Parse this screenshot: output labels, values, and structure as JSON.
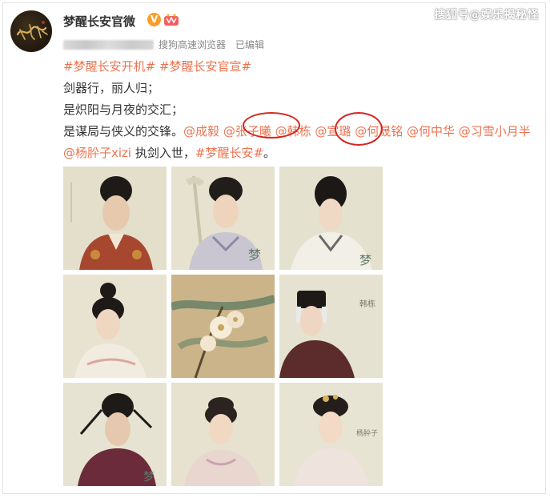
{
  "watermark": "搜狐号@娱乐揭秘怪",
  "account": {
    "name": "梦醒长安官微",
    "verified_mark": "V",
    "avatar_calligraphy": "梦醒长安"
  },
  "meta": {
    "source": "搜狗高速浏览器",
    "edited": "已编辑"
  },
  "post": {
    "hashtag_1": "#梦醒长安开机#",
    "hashtag_2": "#梦醒长安官宣#",
    "line_1": "剑器行，丽人归；",
    "line_2": "是炽阳与月夜的交汇；",
    "line_3_prefix": "是谋局与侠义的交锋。",
    "mentions": [
      "@成毅",
      "@张子曦",
      "@韩栋",
      "@宣璐",
      "@何晟铭",
      "@何中华",
      "@习雪小月半",
      "@杨肸子xizi"
    ],
    "line_3_suffix_1": "执剑入世，",
    "hashtag_3": "#梦醒长安#",
    "line_3_end": "。"
  },
  "colors": {
    "accent": "#eb7350",
    "circle": "#d3271f",
    "vip": "#fa9d2b"
  },
  "images": [
    {
      "name": "poster-man-red-robe"
    },
    {
      "name": "poster-woman-sword"
    },
    {
      "name": "poster-man-white-robe"
    },
    {
      "name": "poster-woman-hair-bun"
    },
    {
      "name": "poster-center-flowers"
    },
    {
      "name": "poster-older-man-white-hair"
    },
    {
      "name": "poster-man-purple-robe"
    },
    {
      "name": "poster-woman-smiling"
    },
    {
      "name": "poster-woman-headdress"
    }
  ]
}
